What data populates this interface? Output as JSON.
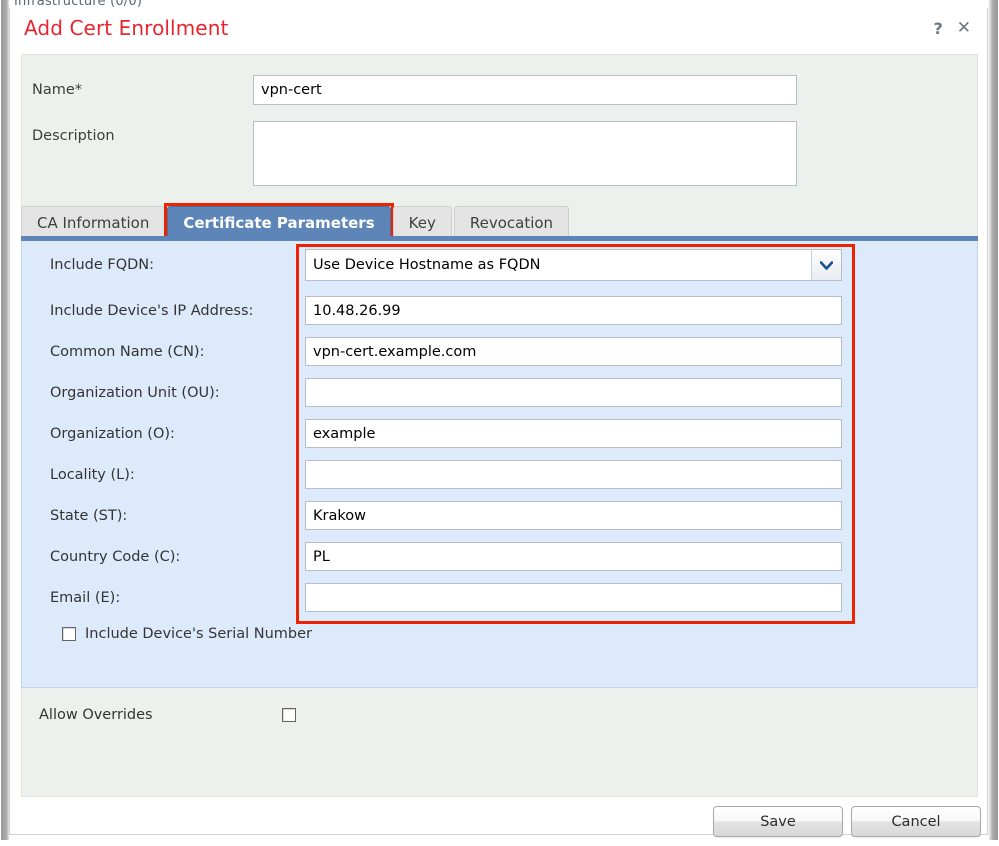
{
  "background": {
    "partial_text": "Infrastructure (0/0)"
  },
  "dialog": {
    "title": "Add Cert Enrollment",
    "help_icon": "?",
    "close_icon": "✕",
    "name_label": "Name*",
    "name_value": "vpn-cert",
    "name_placeholder": "",
    "description_label": "Description",
    "description_value": "",
    "description_placeholder": ""
  },
  "tabs": [
    {
      "label": "CA Information",
      "active": false,
      "highlighted": false
    },
    {
      "label": "Certificate Parameters",
      "active": true,
      "highlighted": true
    },
    {
      "label": "Key",
      "active": false,
      "highlighted": false
    },
    {
      "label": "Revocation",
      "active": false,
      "highlighted": false
    }
  ],
  "certificate_parameters": {
    "include_fqdn": {
      "label": "Include FQDN:",
      "value": "Use Device Hostname as FQDN",
      "control": "select",
      "arrow_icon": "chevron-down-icon"
    },
    "include_device_ip": {
      "label": "Include Device's IP Address:",
      "value": "10.48.26.99"
    },
    "common_name": {
      "label": "Common Name (CN):",
      "value": "vpn-cert.example.com"
    },
    "organization_unit": {
      "label": "Organization Unit (OU):",
      "value": ""
    },
    "organization": {
      "label": "Organization (O):",
      "value": "example"
    },
    "locality": {
      "label": "Locality (L):",
      "value": ""
    },
    "state": {
      "label": "State (ST):",
      "value": "Krakow"
    },
    "country_code": {
      "label": "Country Code (C):",
      "value": "PL"
    },
    "email": {
      "label": "Email (E):",
      "value": ""
    },
    "include_serial_number": {
      "label": "Include Device's Serial Number",
      "checked": false
    }
  },
  "allow_overrides": {
    "label": "Allow Overrides",
    "checked": false
  },
  "footer": {
    "save_label": "Save",
    "cancel_label": "Cancel"
  },
  "colors": {
    "title_red": "#e8252f",
    "highlight_red": "#ee2200",
    "tab_active_blue": "#5d85b7",
    "panel_blue": "#ddeafb",
    "body_grey": "#edf1ee"
  }
}
